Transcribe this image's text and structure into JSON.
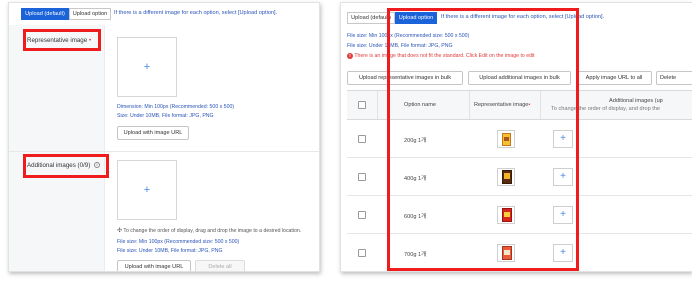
{
  "left": {
    "tabs": [
      {
        "label": "Upload (default)",
        "active": true
      },
      {
        "label": "Upload option",
        "active": false
      }
    ],
    "hint": "If there is a different image for each option, select [Upload option].",
    "representative": {
      "label": "Representative image",
      "required_mark": "•",
      "dimension": "Dimension: Min 100px (Recommended: 500 x 500)",
      "size": "Size: Under 10MB, File format: JPG, PNG",
      "url_button": "Upload with image URL"
    },
    "additional": {
      "label": "Additional images (0/9)",
      "info": "i",
      "reorder_hint": "To change the order of display, drag and drop the image to a desired location.",
      "file_size": "File size: Min 100px (Recommended size: 500 x 500)",
      "file_format": "File size: Under 10MB, File format: JPG, PNG",
      "url_button": "Upload with image URL",
      "delete_button": "Delete all"
    }
  },
  "right": {
    "tabs": [
      {
        "label": "Upload (default)",
        "active": false
      },
      {
        "label": "Upload option",
        "active": true
      }
    ],
    "hint": "If there is a different image for each option, select [Upload option].",
    "file_size": "File size: Min 100px (Recommended size: 500 x 500)",
    "file_format": "File size: Under 10MB, File format: JPG, PNG",
    "warning": "There is an image that does not fit the standard. Click Edit on the image to edit",
    "toolbar": [
      "Upload representative images in bulk",
      "Upload additional images in bulk",
      "Apply image URL to all",
      "Delete"
    ],
    "table": {
      "headers": {
        "option_name": "Option name",
        "representative": "Representative image",
        "required_mark": "•",
        "additional": "Additional images (up",
        "additional_sub": "To change the order of display, and drop the"
      },
      "rows": [
        {
          "name": "200g 1개"
        },
        {
          "name": "400g 1개"
        },
        {
          "name": "600g 1개"
        },
        {
          "name": "700g 1개"
        }
      ]
    }
  },
  "colors": {
    "accent": "#1a63d8",
    "highlight": "#ee1c1c",
    "hint_text": "#2b55b8"
  },
  "icons": {
    "plus": "+",
    "warning": "!"
  }
}
